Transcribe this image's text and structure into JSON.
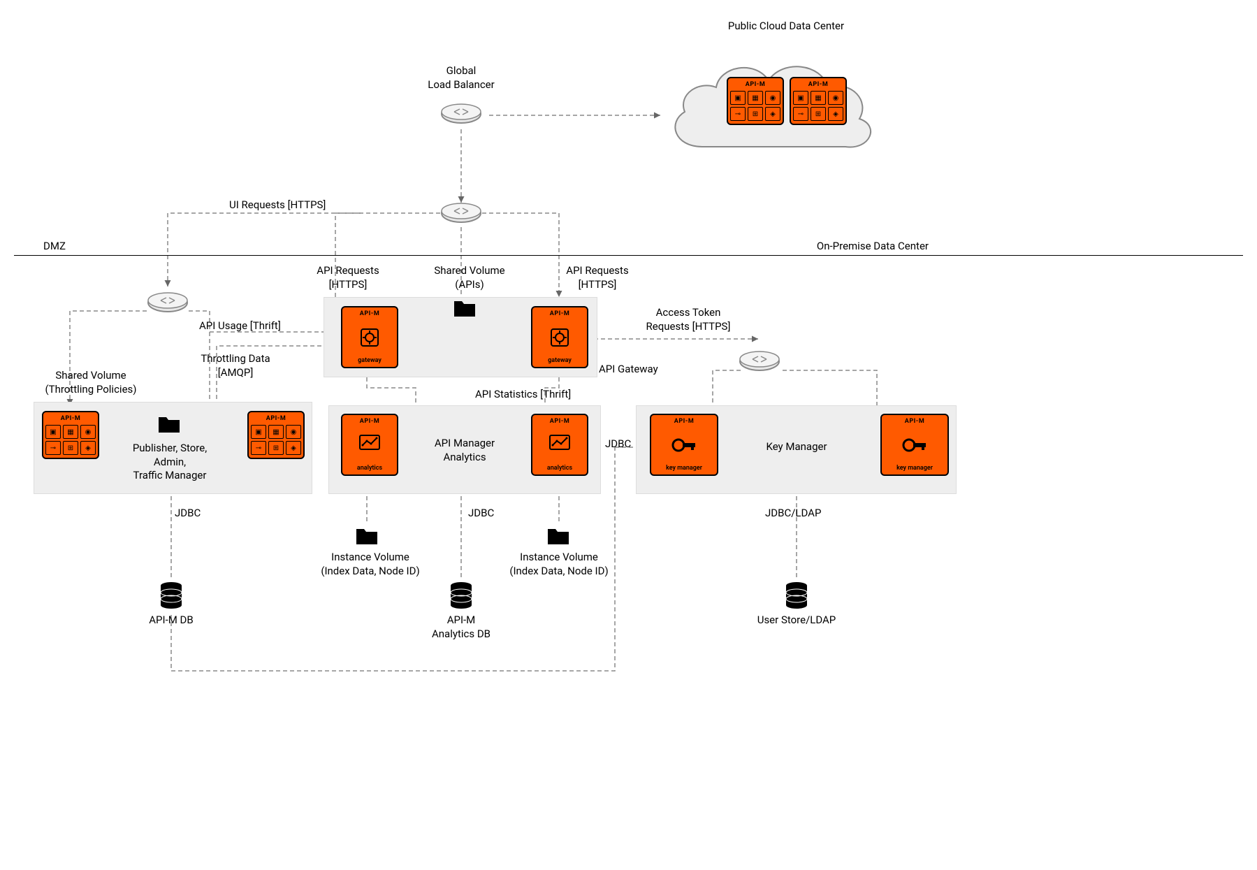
{
  "title_cloud": "Public Cloud Data Center",
  "title_glb_1": "Global",
  "title_glb_2": "Load Balancer",
  "dmz": "DMZ",
  "onprem": "On-Premise Data Center",
  "ui_requests": "UI Requests [HTTPS]",
  "api_req_l1": "API Requests",
  "api_req_l2": "[HTTPS]",
  "shared_apis_1": "Shared Volume",
  "shared_apis_2": "(APIs)",
  "api_usage": "API Usage [Thrift]",
  "throttling_1": "Throttling Data",
  "throttling_2": "[AMQP]",
  "shared_pol_1": "Shared Volume",
  "shared_pol_2": "(Throttling Policies)",
  "pub_1": "Publisher, Store,",
  "pub_2": "Admin,",
  "pub_3": "Traffic Manager",
  "api_gateway": "API Gateway",
  "api_stats": "API Statistics [Thrift]",
  "analytics_1": "API Manager",
  "analytics_2": "Analytics",
  "access_1": "Access Token",
  "access_2": "Requests [HTTPS]",
  "key_mgr": "Key Manager",
  "jdbc": "JDBC",
  "jdbc_ldap": "JDBC/LDAP",
  "apim_db": "API-M DB",
  "analytics_db_1": "API-M",
  "analytics_db_2": "Analytics DB",
  "user_store": "User Store/LDAP",
  "inst_vol_1": "Instance Volume",
  "inst_vol_2": "(Index Data, Node ID)",
  "apim_hdr": "API-M",
  "ftr_gateway": "gateway",
  "ftr_analytics": "analytics",
  "ftr_keymgr": "key manager"
}
